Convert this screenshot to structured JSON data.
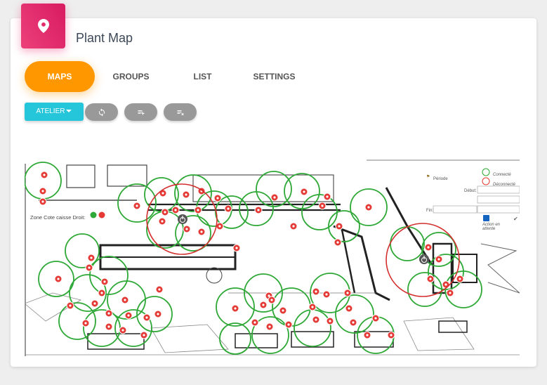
{
  "page": {
    "title": "Plant Map"
  },
  "tabs": [
    {
      "label": "MAPS",
      "active": true
    },
    {
      "label": "GROUPS",
      "active": false
    },
    {
      "label": "LIST",
      "active": false
    },
    {
      "label": "SETTINGS",
      "active": false
    }
  ],
  "toolbar": {
    "dropdown_label": "ATELIER",
    "buttons": [
      {
        "icon": "refresh-icon"
      },
      {
        "icon": "playlist-add-icon"
      },
      {
        "icon": "playlist-remove-icon"
      }
    ]
  },
  "map": {
    "zone_label": "Zone Cote caisse Droit:",
    "legend": {
      "periode": "Période",
      "connected": "Connecté",
      "disconnected": "Déconnecté",
      "debut": "Début:",
      "fin": "Fin:",
      "action_line1": "Action en",
      "action_line2": "attente"
    },
    "colors": {
      "connected": "#2ea836",
      "disconnected": "#e53935",
      "highlight": "#d32f2f"
    }
  }
}
